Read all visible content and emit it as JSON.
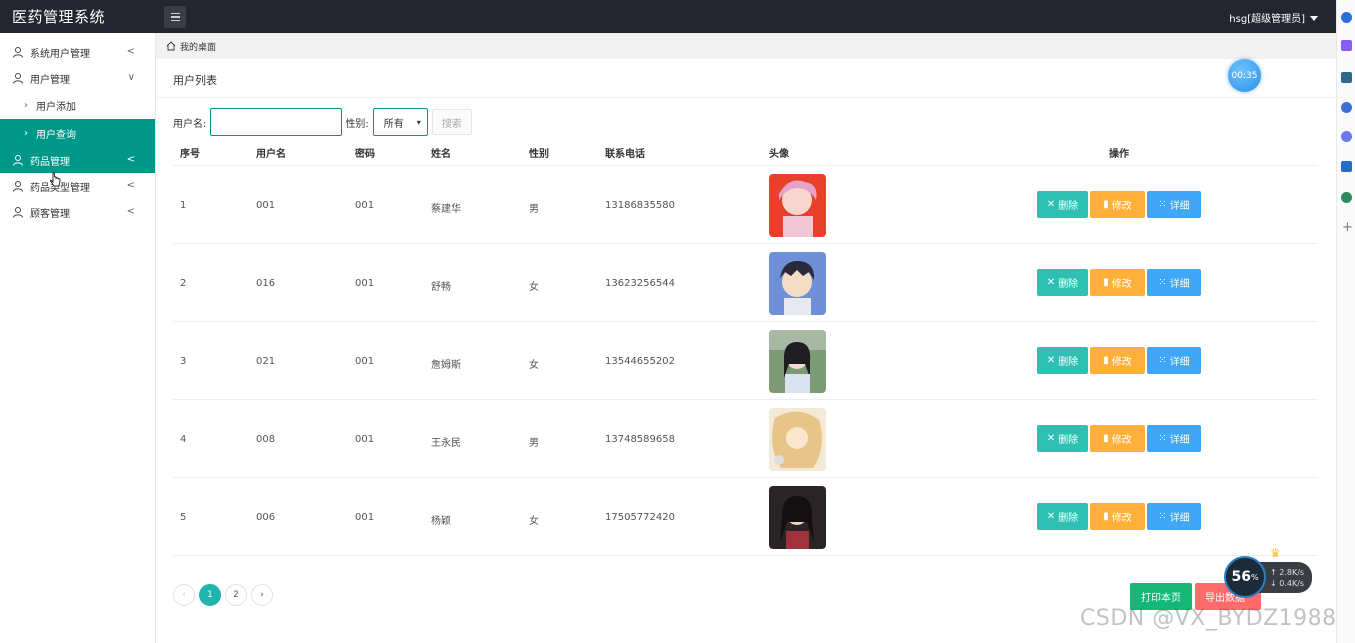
{
  "app": {
    "title": "医药管理系统",
    "user_menu": "hsg[超级管理员]"
  },
  "sidebar": {
    "items": [
      {
        "label": "系统用户管理",
        "arrow": "<"
      },
      {
        "label": "用户管理",
        "arrow": "∨"
      },
      {
        "label": "用户添加"
      },
      {
        "label": "用户查询"
      },
      {
        "label": "药品管理",
        "arrow": "<"
      },
      {
        "label": "药品类型管理",
        "arrow": "<"
      },
      {
        "label": "顾客管理",
        "arrow": "<"
      }
    ]
  },
  "breadcrumb": {
    "home": "我的桌面"
  },
  "panel": {
    "title": "用户列表",
    "timer": "00:35"
  },
  "search": {
    "username_label": "用户名:",
    "username_value": "",
    "gender_label": "性别:",
    "gender_selected": "所有",
    "search_button": "搜索"
  },
  "table": {
    "headers": [
      "序号",
      "用户名",
      "密码",
      "姓名",
      "性别",
      "联系电话",
      "头像",
      "操作"
    ],
    "rows": [
      {
        "no": "1",
        "username": "001",
        "password": "001",
        "name": "蔡建华",
        "gender": "男",
        "phone": "13186835580"
      },
      {
        "no": "2",
        "username": "016",
        "password": "001",
        "name": "舒畅",
        "gender": "女",
        "phone": "13623256544"
      },
      {
        "no": "3",
        "username": "021",
        "password": "001",
        "name": "詹姆斯",
        "gender": "女",
        "phone": "13544655202"
      },
      {
        "no": "4",
        "username": "008",
        "password": "001",
        "name": "王永民",
        "gender": "男",
        "phone": "13748589658"
      },
      {
        "no": "5",
        "username": "006",
        "password": "001",
        "name": "杨颖",
        "gender": "女",
        "phone": "17505772420"
      }
    ],
    "actions": {
      "delete": "删除",
      "edit": "修改",
      "detail": "详细"
    }
  },
  "pagination": {
    "prev": "‹",
    "pages": [
      "1",
      "2"
    ],
    "current": "1",
    "next": "›"
  },
  "footer_buttons": {
    "print": "打印本页",
    "export": "导出数据"
  },
  "overlay": {
    "net_percent": "56",
    "net_percent_unit": "%",
    "upload_speed": "↑ 2.8K/s",
    "download_speed": "↓ 0.4K/s",
    "watermark": "CSDN @VX_BYDZ1988"
  },
  "colors": {
    "accent": "#009688",
    "topbar": "#23262e",
    "delete": "#2fbfb3",
    "edit": "#ffb03b",
    "detail": "#3fa7f5",
    "print": "#16b777",
    "export": "#ff6b6b"
  }
}
